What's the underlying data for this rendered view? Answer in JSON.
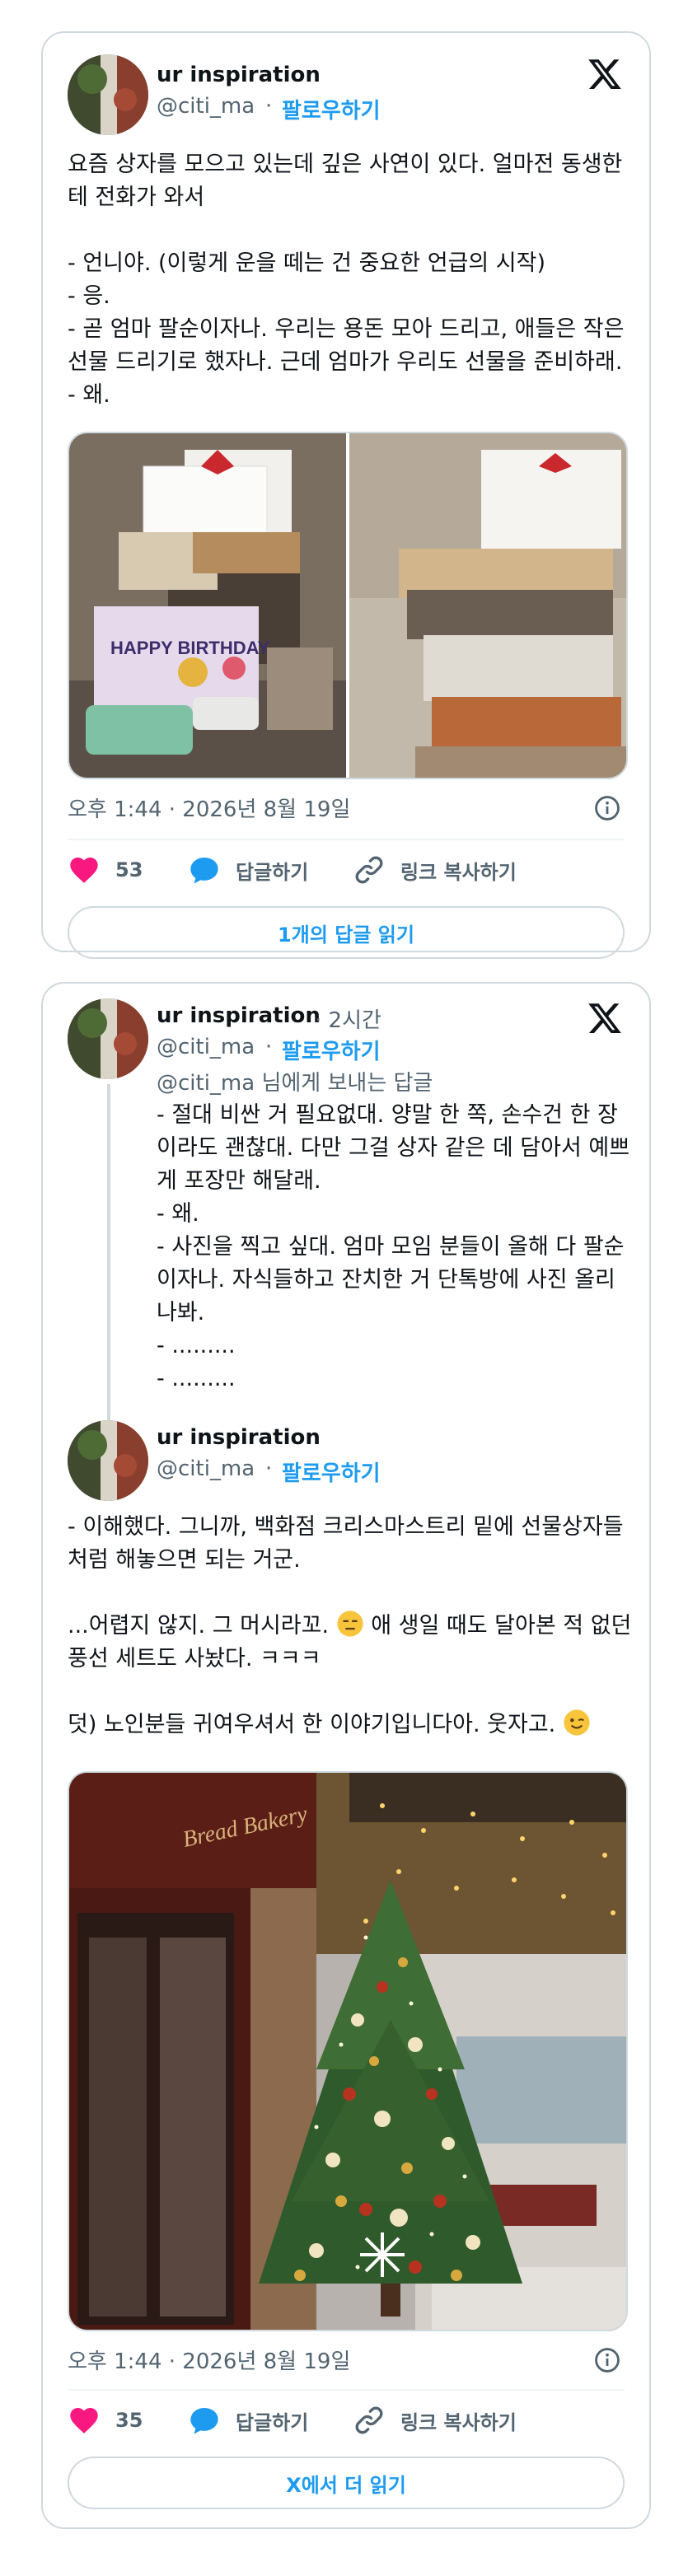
{
  "tweet1": {
    "name": "ur inspiration",
    "handle": "@citi_ma",
    "sep": "·",
    "follow": "팔로우하기",
    "text": "요즘 상자를 모으고 있는데 깊은 사연이 있다. 얼마전 동생한테 전화가 와서\n\n- 언니야. (이렇게 운을 떼는 건 중요한 언급의 시작)\n- 응.\n- 곧 엄마 팔순이자나. 우리는 용돈 모아 드리고, 애들은 작은 선물 드리기로 했자나. 근데 엄마가 우리도 선물을 준비하래.\n- 왜.",
    "image_left_sign": "HAPPY BIRTHDAY",
    "timestamp": "오후 1:44 · 2026년 8월 19일",
    "likes": "53",
    "reply_label": "답글하기",
    "copy_link_label": "링크 복사하기",
    "read_replies": "1개의 답글 읽기"
  },
  "tweet2": {
    "name": "ur inspiration",
    "time_ago": "· 2시간",
    "handle": "@citi_ma",
    "sep": "·",
    "follow": "팔로우하기",
    "replying_to": "@citi_ma 님에게 보내는 답글",
    "reply_text": "- 절대 비싼 거 필요없대. 양말 한 쪽, 손수건 한 장이라도 괜찮대. 다만 그걸 상자 같은 데 담아서 예쁘게 포장만 해달래.\n- 왜.\n- 사진을 찍고 싶대. 엄마 모임 분들이 올해 다 팔순이자나. 자식들하고 잔치한 거 단톡방에 사진 올리나봐.\n- .........\n- .........",
    "name2": "ur inspiration",
    "handle2": "@citi_ma",
    "follow2": "팔로우하기",
    "text_p1": "- 이해했다. 그니까, 백화점 크리스마스트리 밑에 선물상자들처럼 해놓으면 되는 거군.",
    "text_p2a": "...어렵지 않지. 그 머시라꼬.",
    "text_p2b": " 애 생일 때도 달아본 적 없던 풍선 세트도 사놨다. ㅋㅋㅋ",
    "text_p3": "덧) 노인분들 귀여우셔서 한 이야기입니다아. 웃자고.",
    "storefront_sign": "Bread Bakery",
    "timestamp": "오후 1:44 · 2026년 8월 19일",
    "likes": "35",
    "reply_label": "답글하기",
    "copy_link_label": "링크 복사하기",
    "read_more": "X에서 더 읽기"
  },
  "colors": {
    "accent": "#1d9bf0",
    "like": "#f91880",
    "text": "#0f1419",
    "secondary": "#536471",
    "border": "#cfd9de"
  },
  "icons": [
    "x-logo-icon",
    "heart-icon",
    "reply-bubble-icon",
    "link-icon",
    "info-icon",
    "expressionless-emoji-icon",
    "wink-emoji-icon"
  ]
}
